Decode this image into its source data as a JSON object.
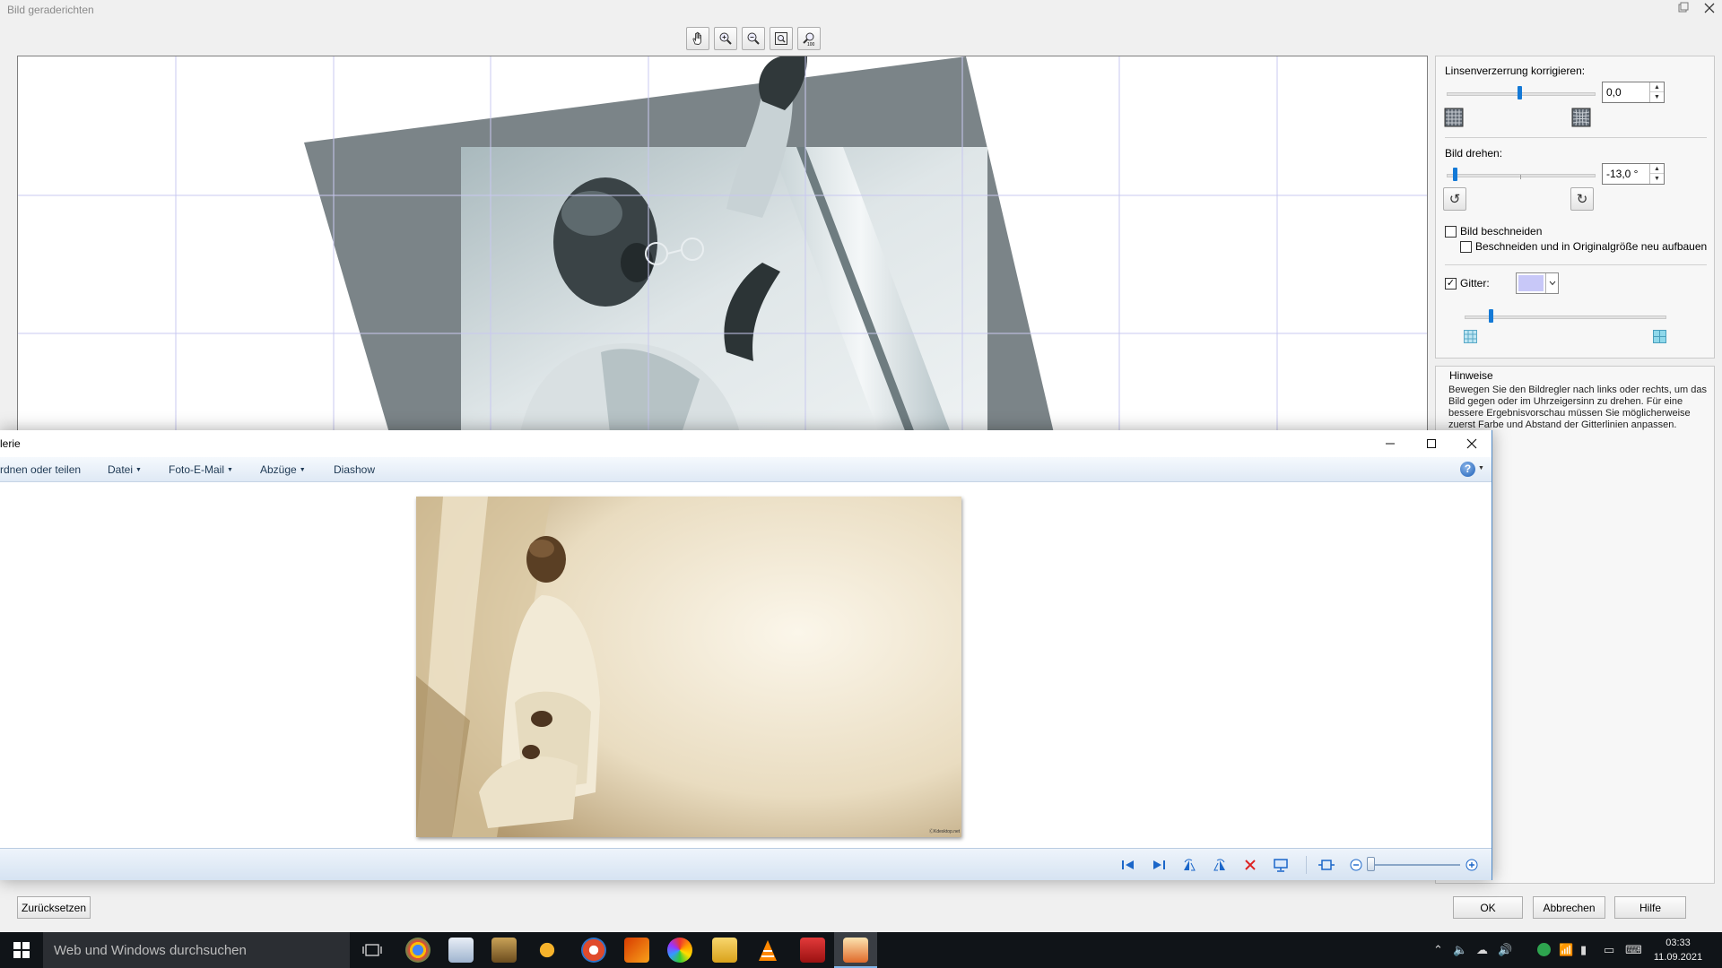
{
  "dialog": {
    "title": "Bild geraderichten",
    "toolbar": [
      "hand-icon",
      "zoom-in-icon",
      "zoom-out-icon",
      "fit-to-window-icon",
      "actual-size-icon"
    ],
    "lens": {
      "label": "Linsenverzerrung korrigieren:",
      "value": "0,0",
      "slider_fraction": 0.5
    },
    "rotate": {
      "label": "Bild drehen:",
      "value": "-13,0 °",
      "slider_fraction": 0.05
    },
    "crop": {
      "label": "Bild beschneiden",
      "checked": false
    },
    "crop_rebuild": {
      "label": "Beschneiden und in Originalgröße neu aufbauen",
      "checked": false
    },
    "grid": {
      "label": "Gitter:",
      "checked": true,
      "color": "#c8c8f8",
      "slider_fraction": 0.12
    },
    "hints": {
      "title": "Hinweise",
      "text": "Bewegen Sie den Bildregler nach links oder rechts, um das Bild gegen oder im Uhrzeigersinn zu drehen. Für eine bessere Ergebnisvorschau müssen Sie möglicherweise zuerst Farbe und Abstand der Gitterlinien anpassen."
    },
    "buttons": {
      "reset": "Zurücksetzen",
      "ok": "OK",
      "cancel": "Abbrechen",
      "help": "Hilfe"
    }
  },
  "gallery": {
    "title": "lerie",
    "menu": [
      {
        "label": "rdnen oder teilen",
        "arrow": false
      },
      {
        "label": "Datei",
        "arrow": true
      },
      {
        "label": "Foto-E-Mail",
        "arrow": true
      },
      {
        "label": "Abzüge",
        "arrow": true
      },
      {
        "label": "Diashow",
        "arrow": false
      }
    ],
    "photo_watermark": "ⒸKdesktop.net"
  },
  "taskbar": {
    "search_placeholder": "Web und Windows durchsuchen",
    "time": "03:33",
    "date": "11.09.2021"
  },
  "colors": {
    "accent": "#1479d6",
    "grid_line": "#c8c8f0",
    "taskbar": "#101418"
  }
}
